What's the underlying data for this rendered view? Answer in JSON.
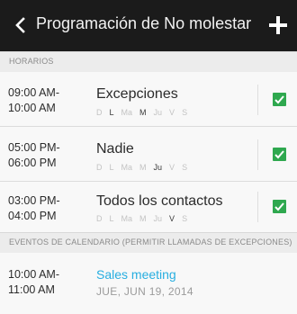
{
  "header": {
    "title": "Programación de No molestar"
  },
  "sections": {
    "schedules": "HORARIOS",
    "calendar": "EVENTOS DE CALENDARIO (PERMITIR LLAMADAS DE EXCEPCIONES)"
  },
  "days_labels": [
    "D",
    "L",
    "Ma",
    "M",
    "Ju",
    "V",
    "S"
  ],
  "schedules": [
    {
      "start": "09:00 AM-",
      "end": "10:00 AM",
      "name": "Excepciones",
      "active_days": [
        "L",
        "M"
      ],
      "checked": true
    },
    {
      "start": "05:00 PM-",
      "end": "06:00 PM",
      "name": "Nadie",
      "active_days": [
        "Ju"
      ],
      "checked": true
    },
    {
      "start": "03:00 PM-",
      "end": "04:00 PM",
      "name": "Todos los contactos",
      "active_days": [
        "V"
      ],
      "checked": true
    }
  ],
  "events": [
    {
      "start": "10:00 AM-",
      "end": "11:00 AM",
      "title": "Sales meeting",
      "date": "JUE, JUN 19, 2014"
    }
  ],
  "colors": {
    "header_bg": "#1b1b1b",
    "check_green": "#2fa84f",
    "event_blue": "#27aee0"
  }
}
